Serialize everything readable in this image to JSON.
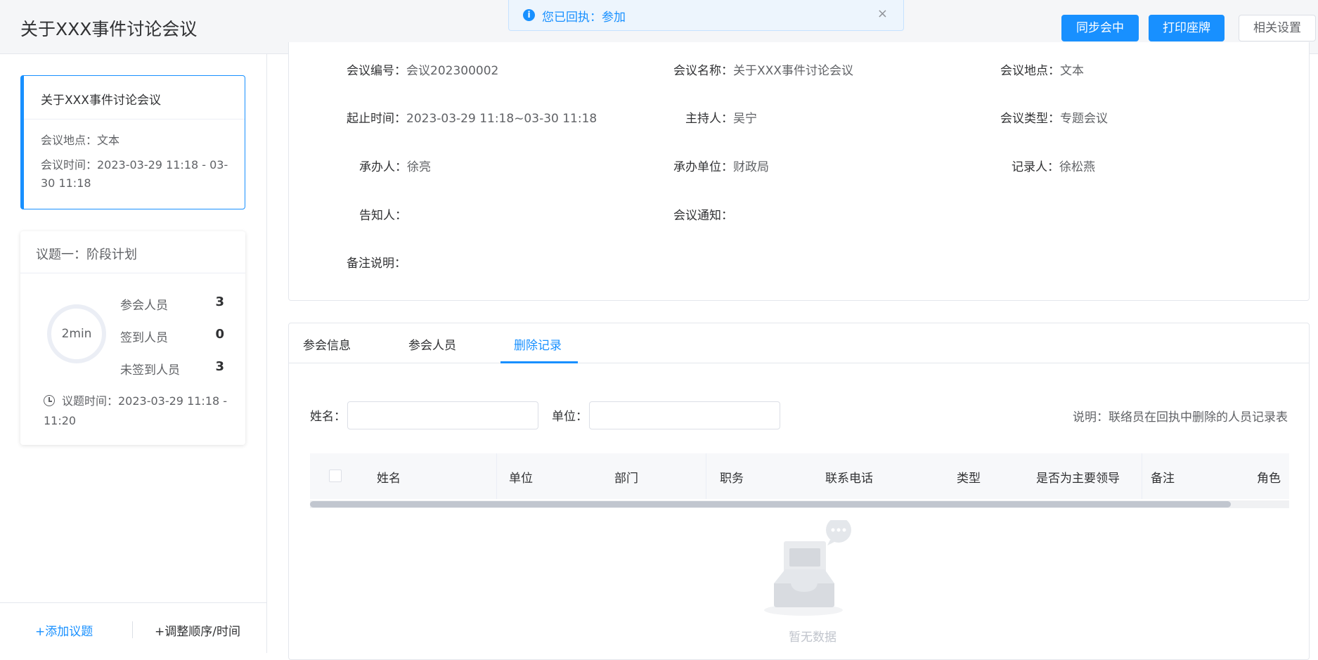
{
  "header": {
    "title": "关于XXX事件讨论会议",
    "buttons": {
      "sync": "同步会中",
      "print": "打印座牌",
      "settings": "相关设置"
    }
  },
  "toast": {
    "message": "您已回执：参加",
    "icon": "info-icon",
    "close": "×"
  },
  "sidebar": {
    "meeting_card": {
      "title": "关于XXX事件讨论会议",
      "location_line": "会议地点：文本",
      "time_line": "会议时间：2023-03-29 11:18 - 03-30 11:18"
    },
    "topic_card": {
      "title": "议题一：阶段计划",
      "duration": "2min",
      "stats": [
        {
          "label": "参会人员",
          "value": "3"
        },
        {
          "label": "签到人员",
          "value": "0"
        },
        {
          "label": "未签到人员",
          "value": "3"
        }
      ],
      "topic_time": "议题时间：2023-03-29 11:18 - 11:20"
    },
    "footer": {
      "add_topic": "+添加议题",
      "adjust_order": "+调整顺序/时间"
    }
  },
  "info": {
    "meeting_no_label": "会议编号：",
    "meeting_no": "会议202300002",
    "meeting_name_label": "会议名称：",
    "meeting_name": "关于XXX事件讨论会议",
    "location_label": "会议地点：",
    "location": "文本",
    "period_label": "起止时间：",
    "period": "2023-03-29 11:18~03-30 11:18",
    "host_label": "主持人：",
    "host": "吴宁",
    "type_label": "会议类型：",
    "type": "专题会议",
    "organizer_label": "承办人：",
    "organizer": "徐亮",
    "unit_label": "承办单位：",
    "unit": "财政局",
    "recorder_label": "记录人：",
    "recorder": "徐松燕",
    "notifier_label": "告知人：",
    "notifier": "",
    "notice_label": "会议通知：",
    "notice": "",
    "remark_label": "备注说明：",
    "remark": ""
  },
  "tabs": [
    {
      "label": "参会信息"
    },
    {
      "label": "参会人员"
    },
    {
      "label": "删除记录"
    }
  ],
  "active_tab": "删除记录",
  "filters": {
    "name_label": "姓名：",
    "name_value": "",
    "unit_label": "单位：",
    "unit_value": ""
  },
  "note": "说明：联络员在回执中删除的人员记录表",
  "table": {
    "columns": [
      "姓名",
      "单位",
      "部门",
      "职务",
      "联系电话",
      "类型",
      "是否为主要领导",
      "备注",
      "角色"
    ],
    "rows": []
  },
  "empty_text": "暂无数据",
  "colors": {
    "primary": "#1890ff",
    "text": "#303133",
    "muted": "#606266"
  }
}
